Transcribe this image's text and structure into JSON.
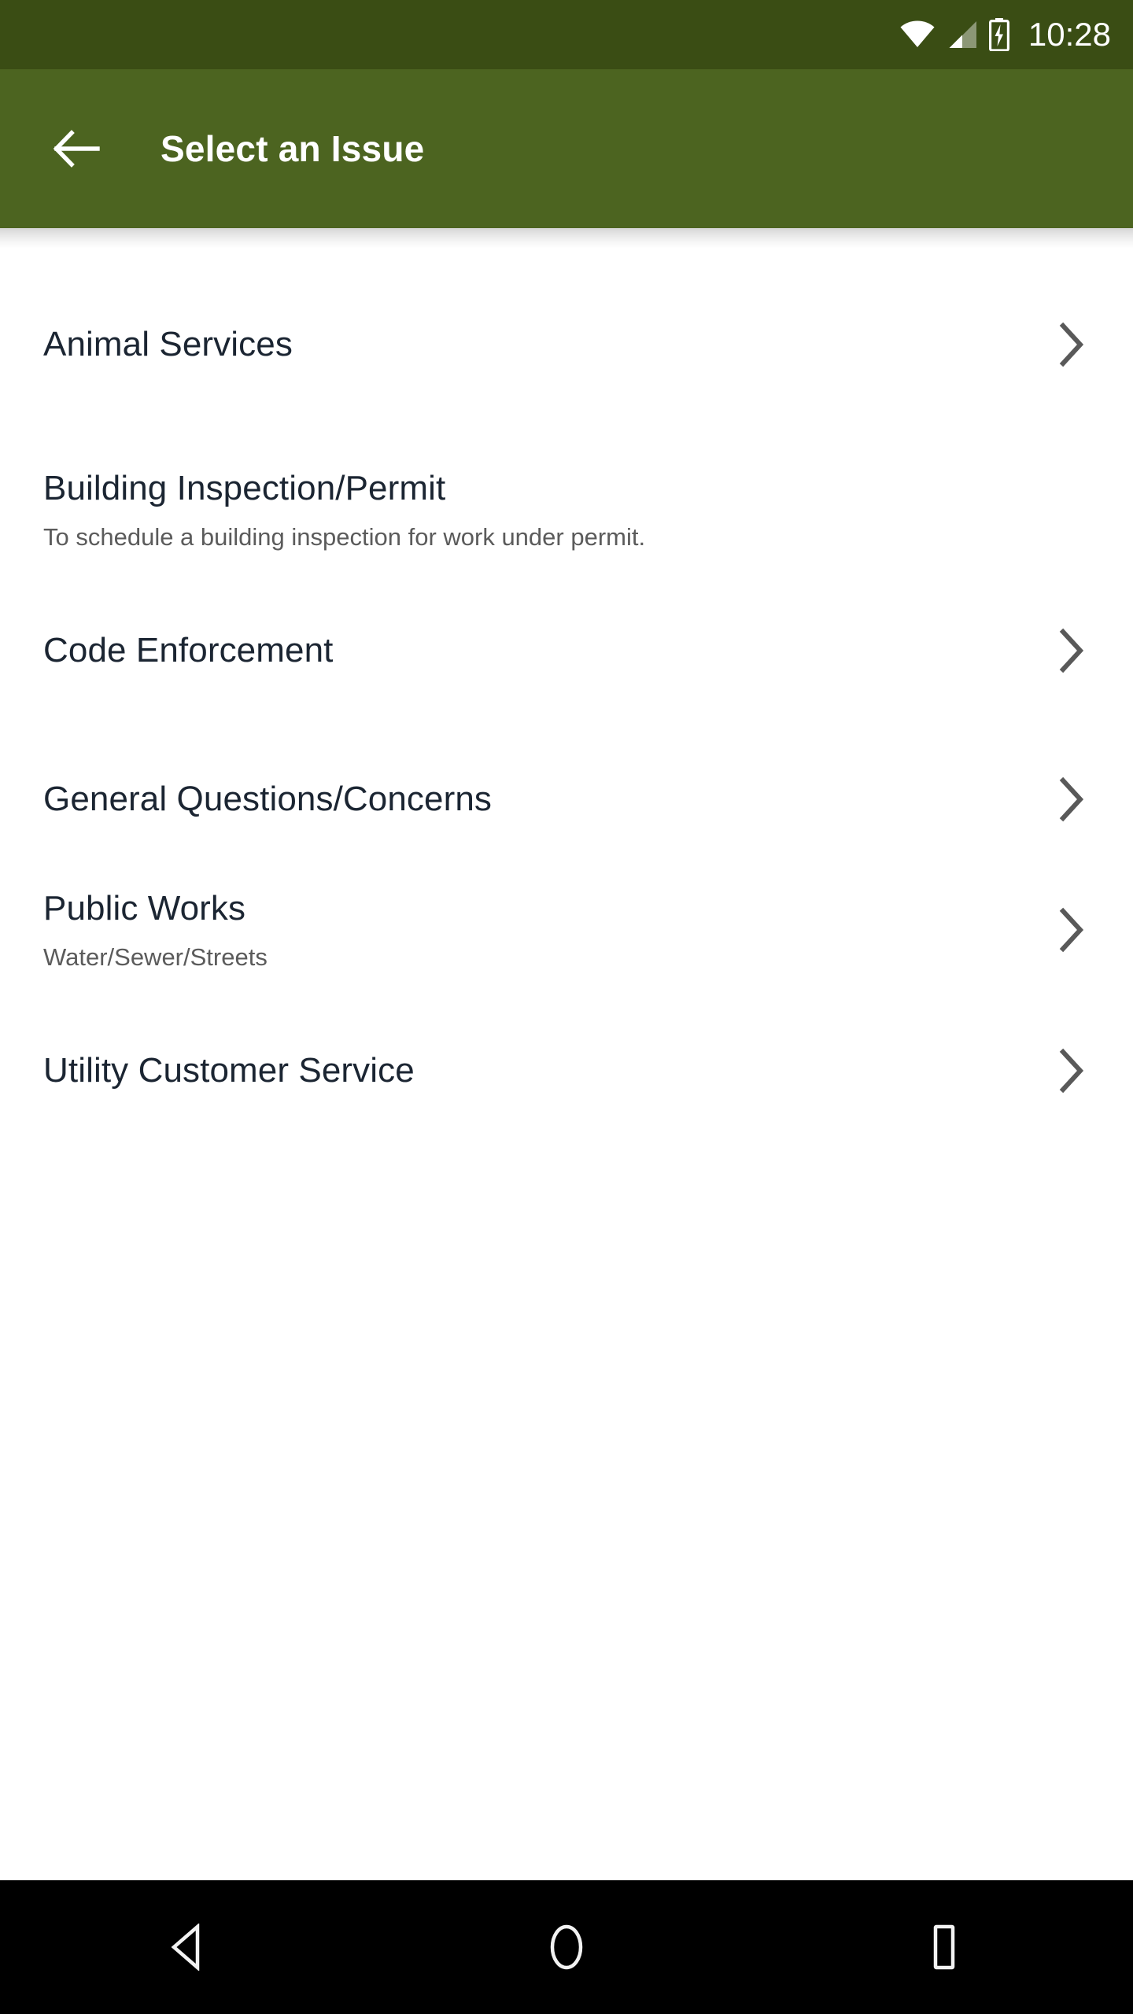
{
  "status_bar": {
    "time": "10:28",
    "background_color": "#3a4d14",
    "icons": [
      "wifi-icon",
      "cell-signal-icon",
      "battery-charging-icon"
    ]
  },
  "toolbar": {
    "title": "Select an Issue",
    "back_icon": "arrow-left-icon",
    "background_color": "#4c6420",
    "text_color": "#ffffff"
  },
  "theme": {
    "accent": "#4c6420",
    "status_bar_dark": "#3a4d14",
    "title_text": "#1b2532",
    "subtitle_text": "#5b5b5b",
    "chevron": "#595959",
    "page_background": "#ffffff",
    "nav_bar": "#000000"
  },
  "list": {
    "items": [
      {
        "title": "Animal Services",
        "subtitle": "",
        "has_chevron": true,
        "chevron_icon": "chevron-right-icon"
      },
      {
        "title": "Building Inspection/Permit",
        "subtitle": "To schedule a building inspection for work under permit.",
        "has_chevron": false,
        "chevron_icon": ""
      },
      {
        "title": "Code Enforcement",
        "subtitle": "",
        "has_chevron": true,
        "chevron_icon": "chevron-right-icon"
      },
      {
        "title": "General Questions/Concerns",
        "subtitle": "",
        "has_chevron": true,
        "chevron_icon": "chevron-right-icon"
      },
      {
        "title": "Public Works",
        "subtitle": "Water/Sewer/Streets",
        "has_chevron": true,
        "chevron_icon": "chevron-right-icon"
      },
      {
        "title": "Utility Customer Service",
        "subtitle": "",
        "has_chevron": true,
        "chevron_icon": "chevron-right-icon"
      }
    ]
  },
  "nav_bar": {
    "buttons": [
      {
        "name": "back",
        "icon": "triangle-back-icon"
      },
      {
        "name": "home",
        "icon": "circle-home-icon"
      },
      {
        "name": "recents",
        "icon": "square-recents-icon"
      }
    ]
  }
}
